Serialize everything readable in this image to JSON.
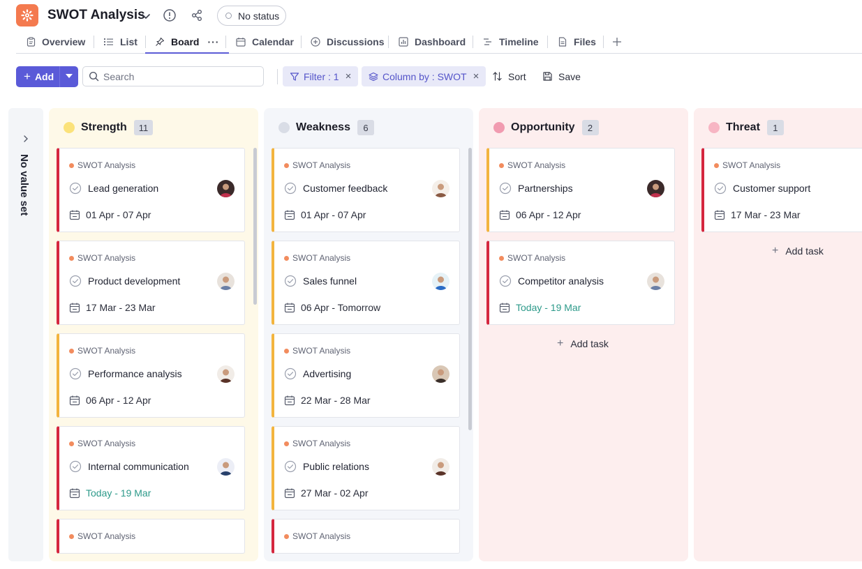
{
  "app": {
    "title": "SWOT Analysis",
    "status": "No status"
  },
  "tabs": [
    {
      "label": "Overview",
      "icon": "clipboard-icon"
    },
    {
      "label": "List",
      "icon": "list-icon"
    },
    {
      "label": "Board",
      "icon": "pin-icon",
      "more": "···"
    },
    {
      "label": "Calendar",
      "icon": "calendar-icon"
    },
    {
      "label": "Discussions",
      "icon": "discussion-icon"
    },
    {
      "label": "Dashboard",
      "icon": "dashboard-icon"
    },
    {
      "label": "Timeline",
      "icon": "timeline-icon"
    },
    {
      "label": "Files",
      "icon": "file-icon"
    }
  ],
  "toolbar": {
    "add_label": "Add",
    "search_placeholder": "Search",
    "filter_label": "Filter : 1",
    "column_label": "Column by : SWOT",
    "sort_label": "Sort",
    "save_label": "Save"
  },
  "board": {
    "no_value_label": "No value set",
    "add_task_label": "Add task",
    "columns": [
      {
        "title": "Strength",
        "count": "11",
        "dot_color": "#fbe27a",
        "bg": "#fef9e8",
        "cards": [
          {
            "project": "SWOT Analysis",
            "task": "Lead generation",
            "date": "01 Apr - 07 Apr",
            "accent": "red",
            "today": false
          },
          {
            "project": "SWOT Analysis",
            "task": "Product development",
            "date": "17 Mar - 23 Mar",
            "accent": "red",
            "today": false
          },
          {
            "project": "SWOT Analysis",
            "task": "Performance analysis",
            "date": "06 Apr - 12 Apr",
            "accent": "amber",
            "today": false
          },
          {
            "project": "SWOT Analysis",
            "task": "Internal communication",
            "date": "Today - 19 Mar",
            "accent": "red",
            "today": true
          },
          {
            "project": "SWOT Analysis",
            "task": "",
            "date": "",
            "accent": "red",
            "today": false
          }
        ]
      },
      {
        "title": "Weakness",
        "count": "6",
        "dot_color": "#d9dde6",
        "bg": "#f4f6fa",
        "cards": [
          {
            "project": "SWOT Analysis",
            "task": "Customer feedback",
            "date": "01 Apr - 07 Apr",
            "accent": "amber",
            "today": false
          },
          {
            "project": "SWOT Analysis",
            "task": "Sales funnel",
            "date": "06 Apr - Tomorrow",
            "accent": "amber",
            "today": false
          },
          {
            "project": "SWOT Analysis",
            "task": "Advertising",
            "date": "22 Mar - 28 Mar",
            "accent": "amber",
            "today": false
          },
          {
            "project": "SWOT Analysis",
            "task": "Public relations",
            "date": "27 Mar - 02 Apr",
            "accent": "amber",
            "today": false
          },
          {
            "project": "SWOT Analysis",
            "task": "",
            "date": "",
            "accent": "red",
            "today": false
          }
        ]
      },
      {
        "title": "Opportunity",
        "count": "2",
        "dot_color": "#f19bb0",
        "bg": "#fdeeee",
        "cards": [
          {
            "project": "SWOT Analysis",
            "task": "Partnerships",
            "date": "06 Apr - 12 Apr",
            "accent": "amber",
            "today": false
          },
          {
            "project": "SWOT Analysis",
            "task": "Competitor analysis",
            "date": "Today - 19 Mar",
            "accent": "red",
            "today": true
          }
        ]
      },
      {
        "title": "Threat",
        "count": "1",
        "dot_color": "#f7b5c3",
        "bg": "#fdeeee",
        "cards": [
          {
            "project": "SWOT Analysis",
            "task": "Customer support",
            "date": "17 Mar - 23 Mar",
            "accent": "red",
            "today": false
          }
        ]
      }
    ]
  }
}
